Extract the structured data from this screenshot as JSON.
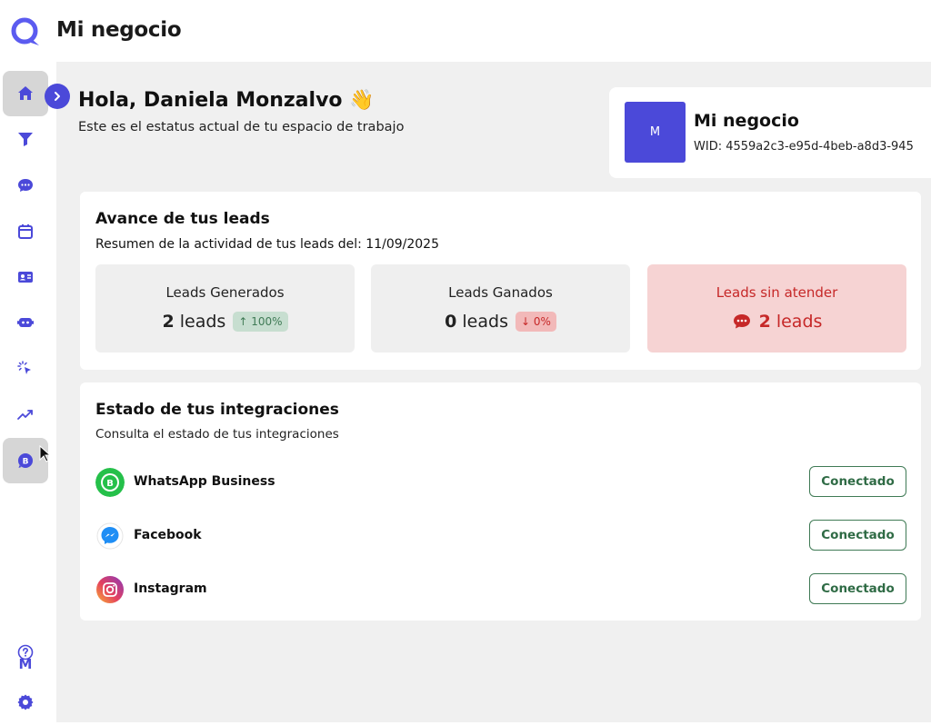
{
  "header": {
    "app_title": "Mi negocio"
  },
  "sidebar": {
    "items": [
      {
        "icon": "home-icon"
      },
      {
        "icon": "funnel-icon"
      },
      {
        "icon": "chat-icon"
      },
      {
        "icon": "calendar-icon"
      },
      {
        "icon": "contact-card-icon"
      },
      {
        "icon": "bot-icon"
      },
      {
        "icon": "click-icon"
      },
      {
        "icon": "trend-icon"
      },
      {
        "icon": "whatsapp-business-icon"
      }
    ],
    "user_initial": "M",
    "bottom_icons": [
      "help-icon",
      "gear-icon"
    ]
  },
  "greeting": {
    "title": "Hola, Daniela Monzalvo 👋",
    "subtitle": "Este es el estatus actual de tu espacio de trabajo"
  },
  "business": {
    "avatar_letter": "M",
    "name": "Mi negocio",
    "wid": "WID: 4559a2c3-e95d-4beb-a8d3-945"
  },
  "leads": {
    "title": "Avance de tus leads",
    "subtitle": "Resumen de la actividad de tus leads del: 11/09/2025",
    "stats": [
      {
        "label": "Leads Generados",
        "count": "2",
        "unit": "leads",
        "badge": "↑ 100%",
        "trend": "up"
      },
      {
        "label": "Leads Ganados",
        "count": "0",
        "unit": "leads",
        "badge": "↓ 0%",
        "trend": "down"
      },
      {
        "label": "Leads sin atender",
        "count": "2",
        "unit": "leads",
        "badge": "",
        "trend": "alert"
      }
    ]
  },
  "integrations": {
    "title": "Estado de tus integraciones",
    "subtitle": "Consulta el estado de tus integraciones",
    "items": [
      {
        "name": "WhatsApp Business",
        "status": "Conectado",
        "icon": "whatsapp-business-icon"
      },
      {
        "name": "Facebook",
        "status": "Conectado",
        "icon": "messenger-icon"
      },
      {
        "name": "Instagram",
        "status": "Conectado",
        "icon": "instagram-icon"
      }
    ]
  },
  "colors": {
    "accent": "#4b49d9",
    "success": "#3f7a55",
    "danger": "#c62828",
    "main_bg": "#f0f0f0"
  }
}
